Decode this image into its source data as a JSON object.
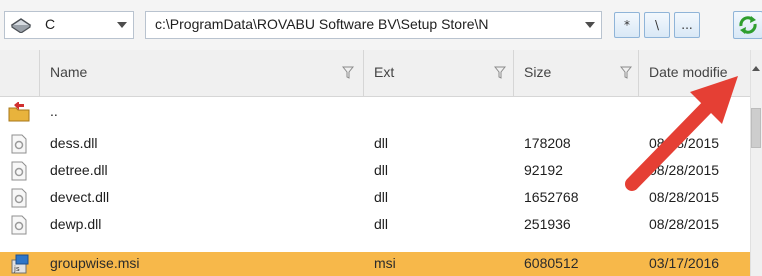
{
  "toolbar": {
    "drive_label": "C",
    "path_value": "c:\\ProgramData\\ROVABU Software BV\\Setup Store\\N",
    "btn_star": "*",
    "btn_backslash": "\\",
    "btn_ellipsis": "..."
  },
  "columns": {
    "name": "Name",
    "ext": "Ext",
    "size": "Size",
    "date": "Date modifie"
  },
  "rows": [
    {
      "name": "..",
      "ext": "",
      "size": "",
      "date": ""
    },
    {
      "name": "dess.dll",
      "ext": "dll",
      "size": "178208",
      "date": "08/28/2015"
    },
    {
      "name": "detree.dll",
      "ext": "dll",
      "size": "92192",
      "date": "08/28/2015"
    },
    {
      "name": "devect.dll",
      "ext": "dll",
      "size": "1652768",
      "date": "08/28/2015"
    },
    {
      "name": "dewp.dll",
      "ext": "dll",
      "size": "251936",
      "date": "08/28/2015"
    },
    {
      "name": "groupwise.msi",
      "ext": "msi",
      "size": "6080512",
      "date": "03/17/2016"
    }
  ],
  "colors": {
    "selected_row": "#f7b84a",
    "annotation_arrow": "#e53f34",
    "selected_text": "#2b2b2b"
  }
}
